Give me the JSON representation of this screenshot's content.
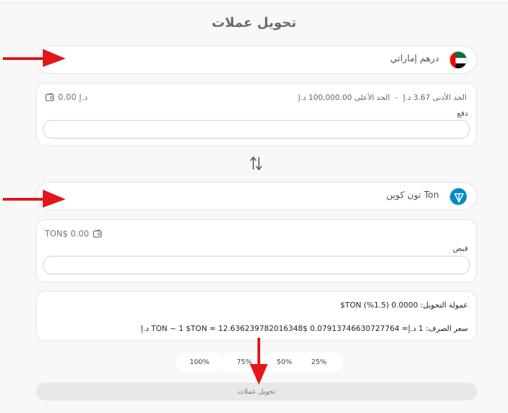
{
  "page": {
    "title": "تحويل عملات"
  },
  "from": {
    "currency_name": "درهم إماراتي",
    "limit_min": "الحد الأدنى 3.67 د.إ",
    "limit_sep": "-",
    "limit_max": "الحد الأعلى 100,000.00 د.إ",
    "balance": "0.00 د.إ",
    "field_label": "دفع",
    "value": ""
  },
  "to": {
    "currency_name": "Ton تون كوين",
    "balance": "TON$ 0.00",
    "field_label": "قبض",
    "value": ""
  },
  "info": {
    "fee": "عمولة التحويل: 0.0000 (1.5%) TON$",
    "rate": "سعر الصرف: 1 د.إ= 0.07913746630727764 $TON ~ 1 $TON = 12.636239782016348 د.إ"
  },
  "percent_buttons": [
    "100%",
    "75%",
    "50%",
    "25%"
  ],
  "convert_button": "تحويل عملات",
  "colors": {
    "annotation_arrow": "#e3161a",
    "ton_blue": "#0088cc",
    "uae_green": "#00732f",
    "uae_red": "#ff0000"
  }
}
